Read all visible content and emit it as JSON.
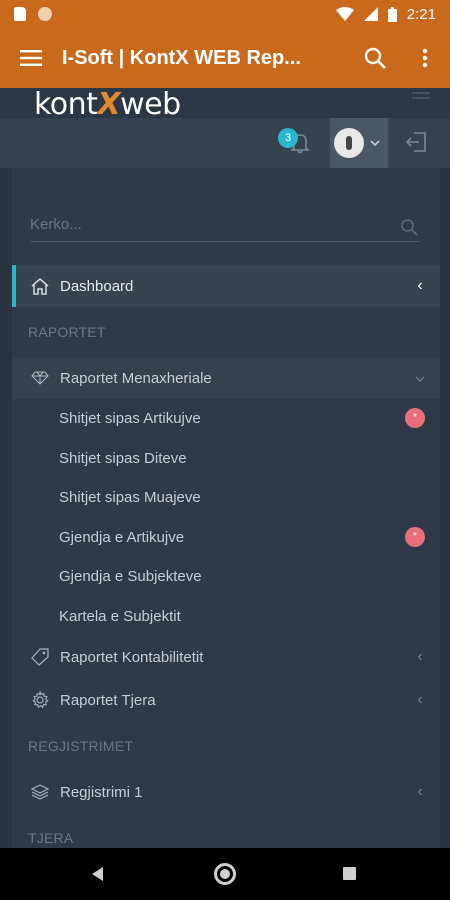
{
  "status_bar": {
    "time": "2:21"
  },
  "app_bar": {
    "title": "I-Soft | KontX WEB Rep..."
  },
  "logo": {
    "part1": "kont",
    "part2": "X",
    "part3": "web"
  },
  "notifications": {
    "count": "3"
  },
  "search": {
    "placeholder": "Kerko..."
  },
  "menu": {
    "dashboard": "Dashboard",
    "section_reports": "RAPORTET",
    "management_reports": "Raportet Menaxheriale",
    "sub_items": [
      "Shitjet sipas Artikujve",
      "Shitjet sipas Diteve",
      "Shitjet sipas Muajeve",
      "Gjendja e Artikujve",
      "Gjendja e Subjekteve",
      "Kartela e Subjektit"
    ],
    "sub_badge": "*",
    "accounting_reports": "Raportet Kontabilitetit",
    "other_reports": "Raportet Tjera",
    "section_registrations": "REGJISTRIMET",
    "registration_1": "Regjistrimi 1",
    "section_other": "TJERA"
  },
  "colors": {
    "brand_orange": "#c8691c",
    "accent_teal": "#29b6c8",
    "badge_red": "#e8707a"
  }
}
